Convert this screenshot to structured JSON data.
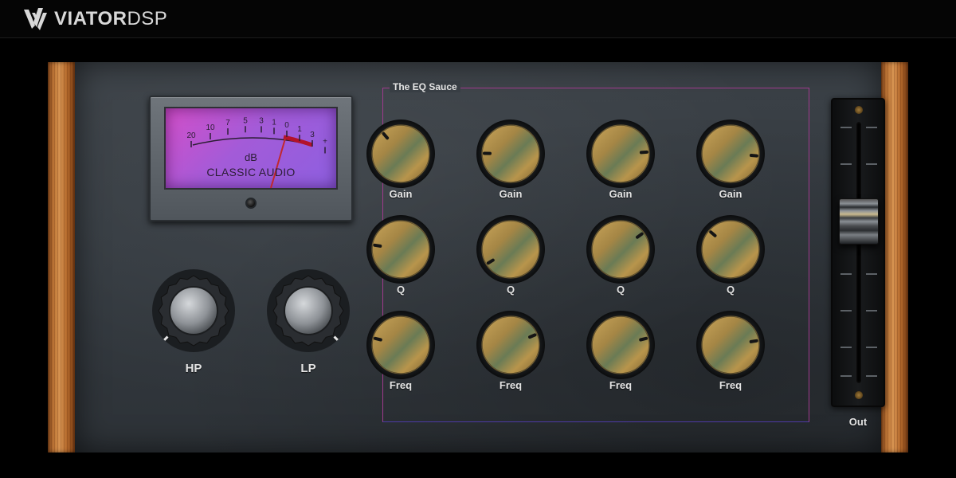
{
  "header": {
    "brand_bold": "VIATOR",
    "brand_light": "DSP",
    "logo_icon": "viator-logo-icon"
  },
  "vu_meter": {
    "scale": [
      "20",
      "10",
      "7",
      "5",
      "3",
      "1",
      "0",
      "1",
      "3",
      "+"
    ],
    "unit": "dB",
    "brand": "CLASSIC AUDIO",
    "needle_db": 0
  },
  "filters": {
    "hp_label": "HP",
    "lp_label": "LP"
  },
  "eq": {
    "title": "The EQ Sauce",
    "rows": [
      {
        "label": "Gain",
        "positions": [
          0.35,
          0.17,
          0.82,
          0.85
        ]
      },
      {
        "label": "Q",
        "positions": [
          0.2,
          0.05,
          0.7,
          0.32
        ]
      },
      {
        "label": "Freq",
        "positions": [
          0.22,
          0.75,
          0.78,
          0.8
        ]
      }
    ]
  },
  "output": {
    "label": "Out"
  },
  "colors": {
    "accent_pink": "#9f3a8d",
    "meter_face": "#a35bd8",
    "knob_brass": "#c9a55a",
    "needle_red": "#c1272d"
  }
}
